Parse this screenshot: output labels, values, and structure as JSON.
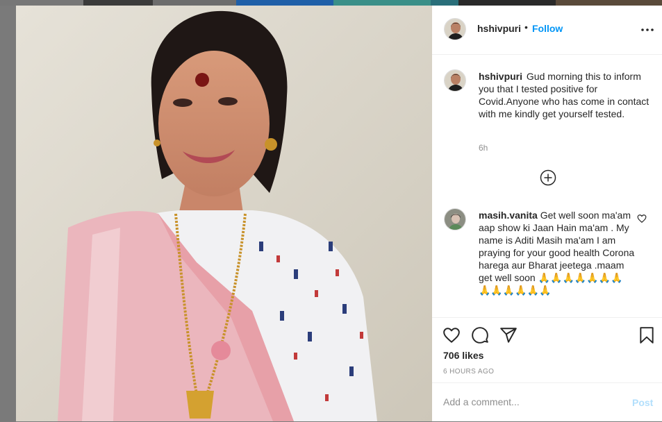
{
  "post": {
    "username": "hshivpuri",
    "dot": "•",
    "follow_label": "Follow",
    "more_icon": "more-dots-icon"
  },
  "caption": {
    "username": "hshivpuri",
    "text": "Gud morning this to inform you that I tested positive for Covid.Anyone who has come in contact with me kindly get yourself tested.",
    "time": "6h"
  },
  "load_more_icon": "plus-circle-icon",
  "comments": [
    {
      "username": "masih.vanita",
      "text": "Get well soon ma'am aap show ki Jaan Hain ma'am . My name is Aditi Masih ma'am I am praying for your good health Corona harega aur Bharat jeetega .maam get well soon 🙏🙏🙏🙏🙏🙏🙏🙏🙏🙏🙏🙏🙏"
    }
  ],
  "actions": {
    "icons": [
      "heart-icon",
      "comment-icon",
      "share-icon",
      "bookmark-icon"
    ],
    "likes": "706 likes",
    "time_ago": "6 HOURS AGO"
  },
  "add_comment": {
    "placeholder": "Add a comment...",
    "post_label": "Post"
  },
  "colors": {
    "link_blue": "#0095f6",
    "post_disabled": "#b2dffc",
    "text": "#262626",
    "muted": "#8e8e8e",
    "border": "#efefef"
  }
}
